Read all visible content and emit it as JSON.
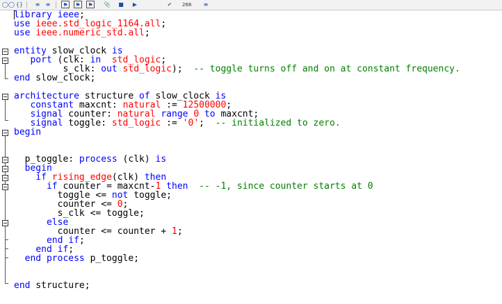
{
  "toolbar": {
    "buttons": [
      "glasses-icon",
      "braces-icon",
      "list-icon",
      "bookmark-prev-icon",
      "bookmark-next-icon",
      "bookmark-clear-icon",
      "attach-icon",
      "marker-icon",
      "check-icon",
      "line-count-icon",
      "lines-icon"
    ],
    "line_count": "268"
  },
  "colors": {
    "keyword": "#0000ff",
    "type": "#ff0000",
    "comment": "#008000",
    "text": "#000000"
  },
  "code_lines": [
    [
      [
        "kw",
        "library"
      ],
      [
        "tx",
        " "
      ],
      [
        "kw",
        "ieee"
      ],
      [
        "tx",
        ";"
      ]
    ],
    [
      [
        "kw",
        "use"
      ],
      [
        "tx",
        " "
      ],
      [
        "ty",
        "ieee.std_logic_1164.all"
      ],
      [
        "tx",
        ";"
      ]
    ],
    [
      [
        "kw",
        "use"
      ],
      [
        "tx",
        " "
      ],
      [
        "ty",
        "ieee.numeric_std.all"
      ],
      [
        "tx",
        ";"
      ]
    ],
    [],
    [
      [
        "kw",
        "entity"
      ],
      [
        "tx",
        " slow_clock "
      ],
      [
        "kw",
        "is"
      ]
    ],
    [
      [
        "tx",
        "   "
      ],
      [
        "kw",
        "port"
      ],
      [
        "tx",
        " (clk: "
      ],
      [
        "kw",
        "in"
      ],
      [
        "tx",
        "  "
      ],
      [
        "ty",
        "std_logic"
      ],
      [
        "tx",
        ";"
      ]
    ],
    [
      [
        "tx",
        "         s_clk: "
      ],
      [
        "kw",
        "out"
      ],
      [
        "tx",
        " "
      ],
      [
        "ty",
        "std_logic"
      ],
      [
        "tx",
        ");  "
      ],
      [
        "cm",
        "-- toggle turns off and on at constant frequency."
      ]
    ],
    [
      [
        "kw",
        "end"
      ],
      [
        "tx",
        " slow_clock;"
      ]
    ],
    [],
    [
      [
        "kw",
        "architecture"
      ],
      [
        "tx",
        " structure "
      ],
      [
        "kw",
        "of"
      ],
      [
        "tx",
        " slow_clock "
      ],
      [
        "kw",
        "is"
      ]
    ],
    [
      [
        "tx",
        "   "
      ],
      [
        "kw",
        "constant"
      ],
      [
        "tx",
        " maxcnt: "
      ],
      [
        "ty",
        "natural"
      ],
      [
        "tx",
        " := "
      ],
      [
        "num",
        "12500000"
      ],
      [
        "tx",
        ";"
      ]
    ],
    [
      [
        "tx",
        "   "
      ],
      [
        "kw",
        "signal"
      ],
      [
        "tx",
        " counter: "
      ],
      [
        "ty",
        "natural"
      ],
      [
        "tx",
        " "
      ],
      [
        "kw",
        "range"
      ],
      [
        "tx",
        " "
      ],
      [
        "num",
        "0"
      ],
      [
        "tx",
        " "
      ],
      [
        "kw",
        "to"
      ],
      [
        "tx",
        " maxcnt;"
      ]
    ],
    [
      [
        "tx",
        "   "
      ],
      [
        "kw",
        "signal"
      ],
      [
        "tx",
        " toggle: "
      ],
      [
        "ty",
        "std_logic"
      ],
      [
        "tx",
        " := "
      ],
      [
        "str",
        "'0'"
      ],
      [
        "tx",
        ";  "
      ],
      [
        "cm",
        "-- initialized to zero."
      ]
    ],
    [
      [
        "kw",
        "begin"
      ]
    ],
    [],
    [],
    [
      [
        "tx",
        "  p_toggle: "
      ],
      [
        "kw",
        "process"
      ],
      [
        "tx",
        " (clk) "
      ],
      [
        "kw",
        "is"
      ]
    ],
    [
      [
        "tx",
        "  "
      ],
      [
        "kw",
        "begin"
      ]
    ],
    [
      [
        "tx",
        "    "
      ],
      [
        "kw",
        "if"
      ],
      [
        "tx",
        " "
      ],
      [
        "ty",
        "rising_edge"
      ],
      [
        "tx",
        "(clk) "
      ],
      [
        "kw",
        "then"
      ]
    ],
    [
      [
        "tx",
        "      "
      ],
      [
        "kw",
        "if"
      ],
      [
        "tx",
        " counter = maxcnt-"
      ],
      [
        "num",
        "1"
      ],
      [
        "tx",
        " "
      ],
      [
        "kw",
        "then"
      ],
      [
        "tx",
        "  "
      ],
      [
        "cm",
        "-- -1, since counter starts at 0"
      ]
    ],
    [
      [
        "tx",
        "        toggle <= "
      ],
      [
        "kw",
        "not"
      ],
      [
        "tx",
        " toggle;"
      ]
    ],
    [
      [
        "tx",
        "        counter <= "
      ],
      [
        "num",
        "0"
      ],
      [
        "tx",
        ";"
      ]
    ],
    [
      [
        "tx",
        "        s_clk <= toggle;"
      ]
    ],
    [
      [
        "tx",
        "      "
      ],
      [
        "kw",
        "else"
      ]
    ],
    [
      [
        "tx",
        "        counter <= counter + "
      ],
      [
        "num",
        "1"
      ],
      [
        "tx",
        ";"
      ]
    ],
    [
      [
        "tx",
        "      "
      ],
      [
        "kw",
        "end if"
      ],
      [
        "tx",
        ";"
      ]
    ],
    [
      [
        "tx",
        "    "
      ],
      [
        "kw",
        "end if"
      ],
      [
        "tx",
        ";"
      ]
    ],
    [
      [
        "tx",
        "  "
      ],
      [
        "kw",
        "end process"
      ],
      [
        "tx",
        " p_toggle;"
      ]
    ],
    [],
    [],
    [
      [
        "kw",
        "end"
      ],
      [
        "tx",
        " structure;"
      ]
    ]
  ]
}
